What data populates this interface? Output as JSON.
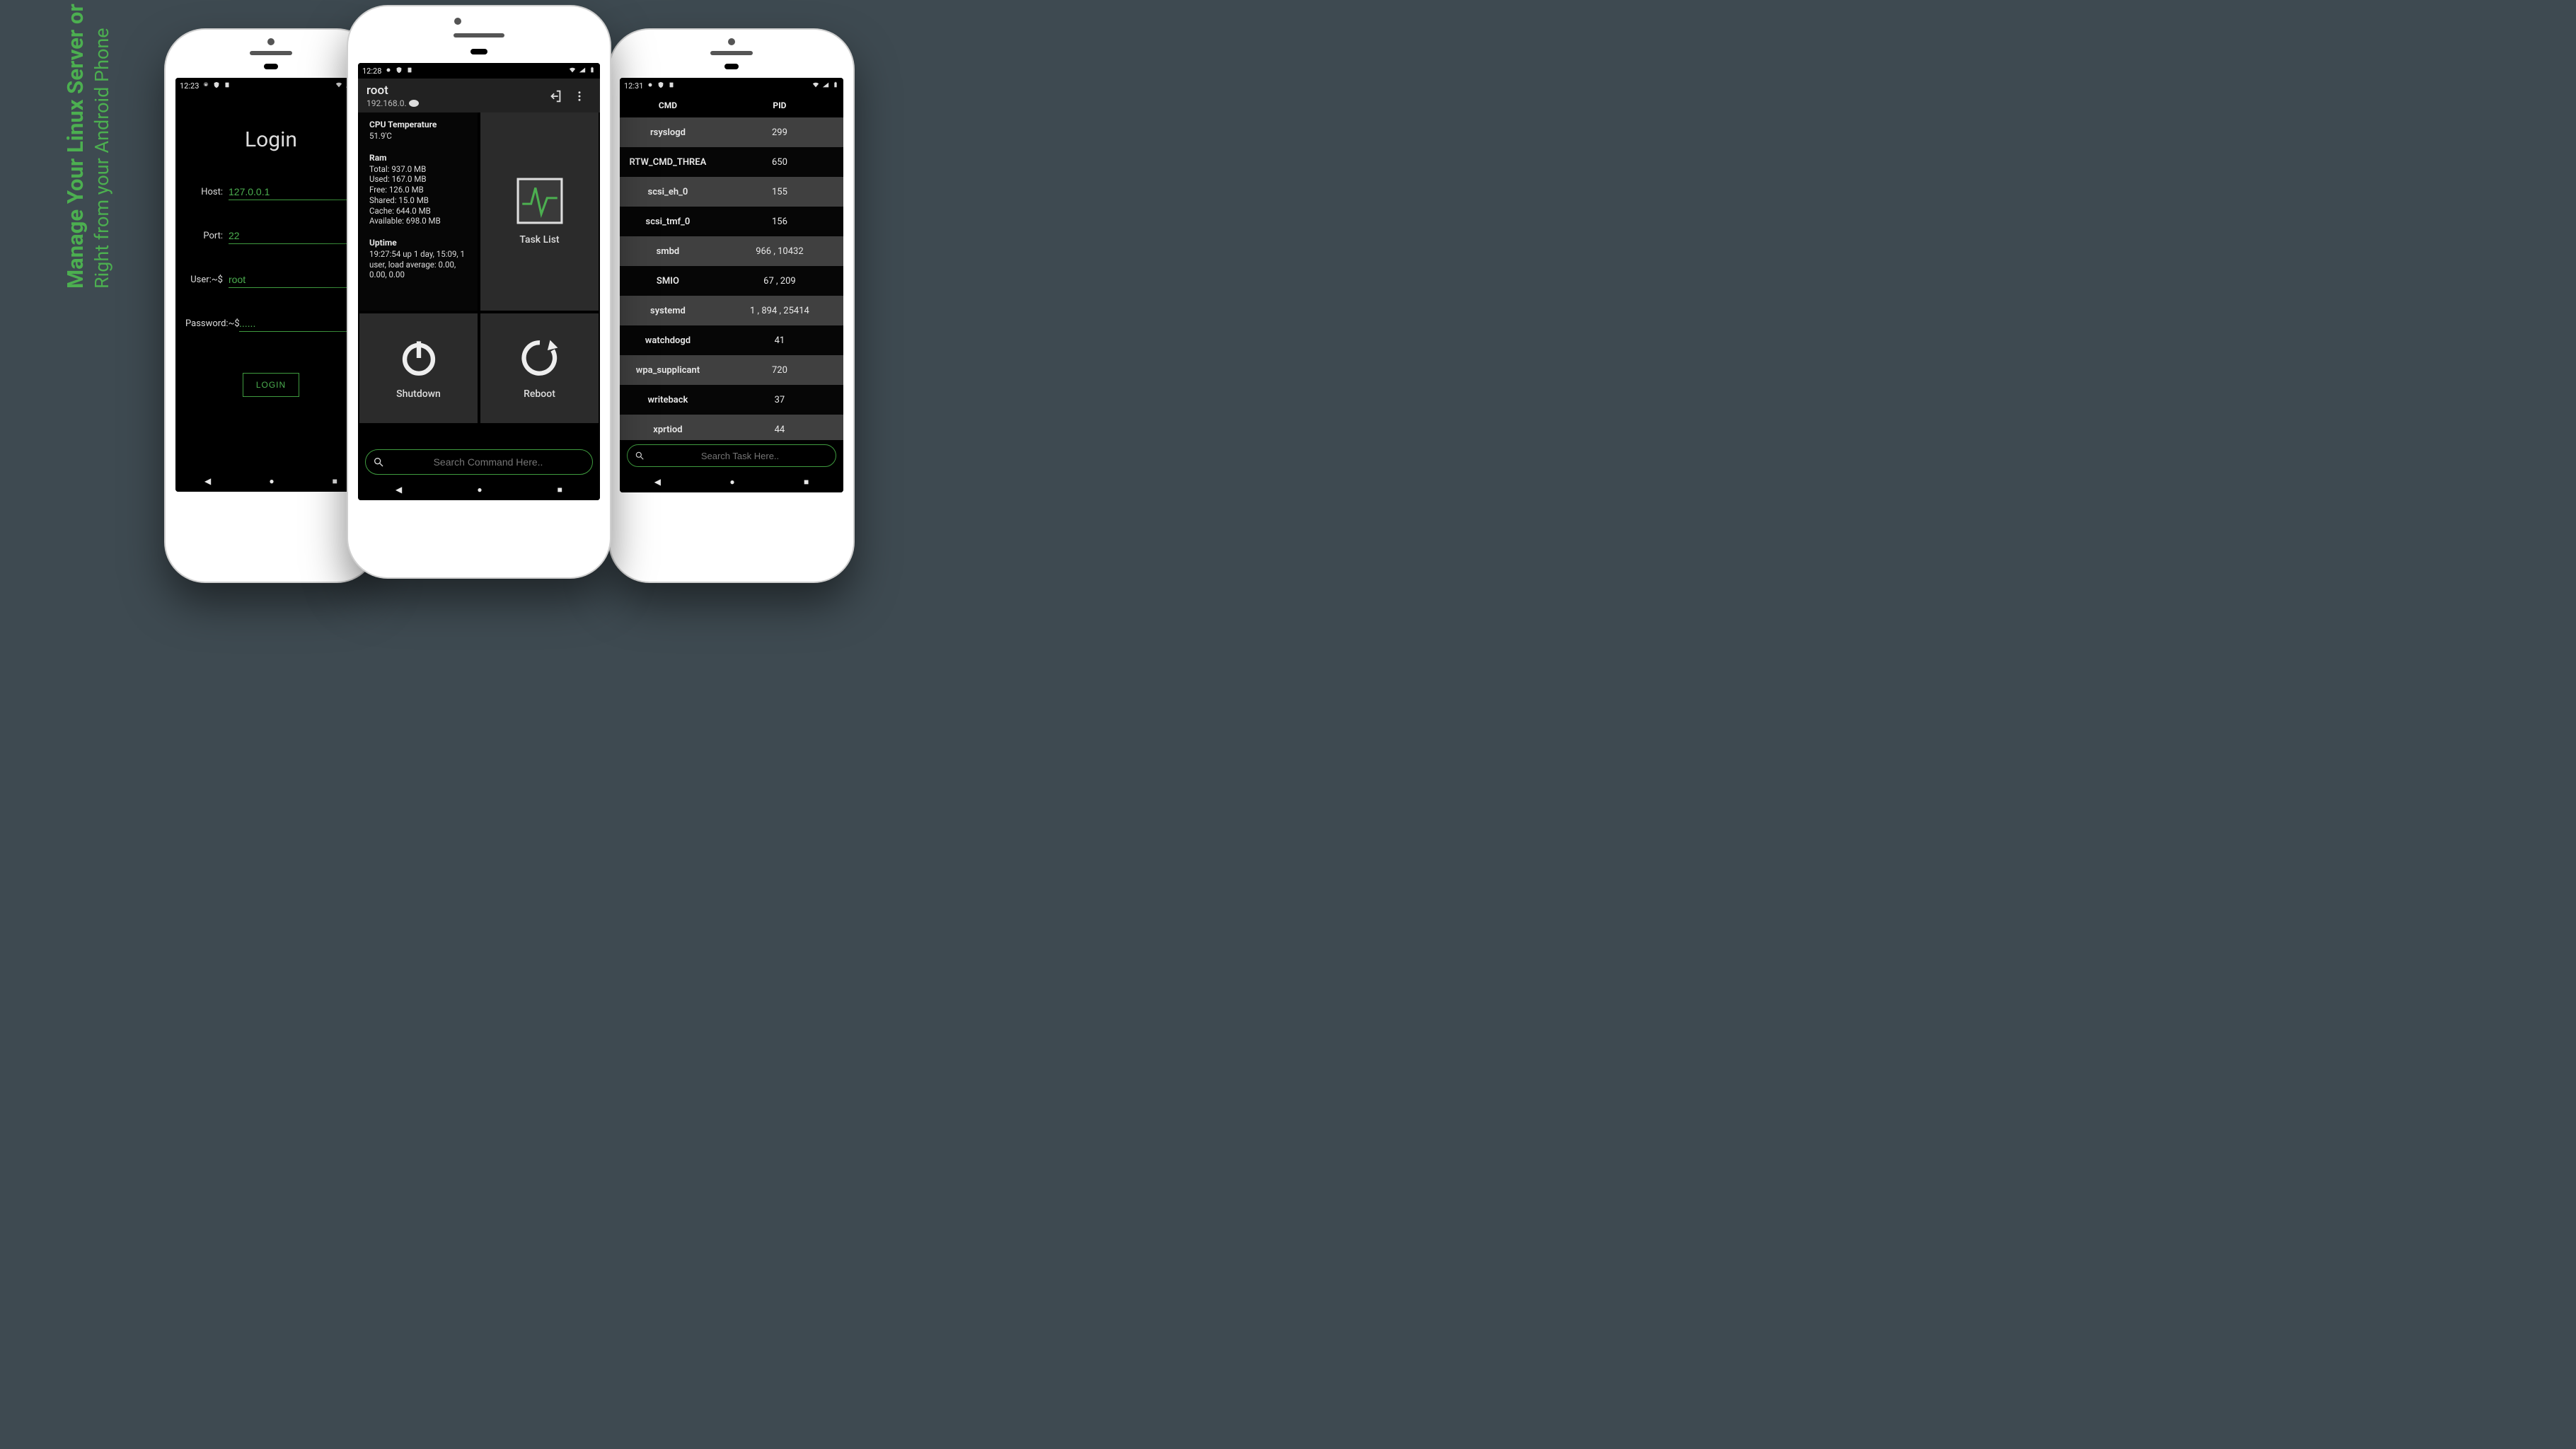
{
  "promo": {
    "line1": "Manage Your Linux Server or Devices",
    "line2": "Right from your Android Phone"
  },
  "login": {
    "statusbar_time": "12:23",
    "title": "Login",
    "fields": {
      "host_label": "Host:",
      "host_value": "127.0.0.1",
      "port_label": "Port:",
      "port_value": "22",
      "user_label": "User:~$",
      "user_value": "root",
      "password_label": "Password:~$",
      "password_value": "......"
    },
    "login_button": "LOGIN"
  },
  "dashboard": {
    "statusbar_time": "12:28",
    "header": {
      "user": "root",
      "ip": "192.168.0."
    },
    "cpu": {
      "heading": "CPU Temperature",
      "value": "51.9'C"
    },
    "ram": {
      "heading": "Ram",
      "total": "Total: 937.0 MB",
      "used": "Used: 167.0 MB",
      "free": "Free: 126.0 MB",
      "shared": "Shared: 15.0 MB",
      "cache": "Cache: 644.0 MB",
      "available": "Available: 698.0 MB"
    },
    "uptime": {
      "heading": "Uptime",
      "value": " 19:27:54 up 1 day, 15:09,  1 user,  load average: 0.00, 0.00, 0.00"
    },
    "tiles": {
      "tasklist": "Task List",
      "shutdown": "Shutdown",
      "reboot": "Reboot"
    },
    "search_placeholder": "Search Command Here.."
  },
  "tasklist": {
    "statusbar_time": "12:31",
    "columns": {
      "cmd": "CMD",
      "pid": "PID"
    },
    "rows": [
      {
        "cmd": "rsyslogd",
        "pid": "299"
      },
      {
        "cmd": "RTW_CMD_THREA",
        "pid": "650"
      },
      {
        "cmd": "scsi_eh_0",
        "pid": "155"
      },
      {
        "cmd": "scsi_tmf_0",
        "pid": "156"
      },
      {
        "cmd": "smbd",
        "pid": "966 , 10432"
      },
      {
        "cmd": "SMIO",
        "pid": "67 , 209"
      },
      {
        "cmd": "systemd",
        "pid": "1 , 894 , 25414"
      },
      {
        "cmd": "watchdogd",
        "pid": "41"
      },
      {
        "cmd": "wpa_supplicant",
        "pid": "720"
      },
      {
        "cmd": "writeback",
        "pid": "37"
      },
      {
        "cmd": "xprtiod",
        "pid": "44"
      }
    ],
    "search_placeholder": "Search Task Here.."
  }
}
